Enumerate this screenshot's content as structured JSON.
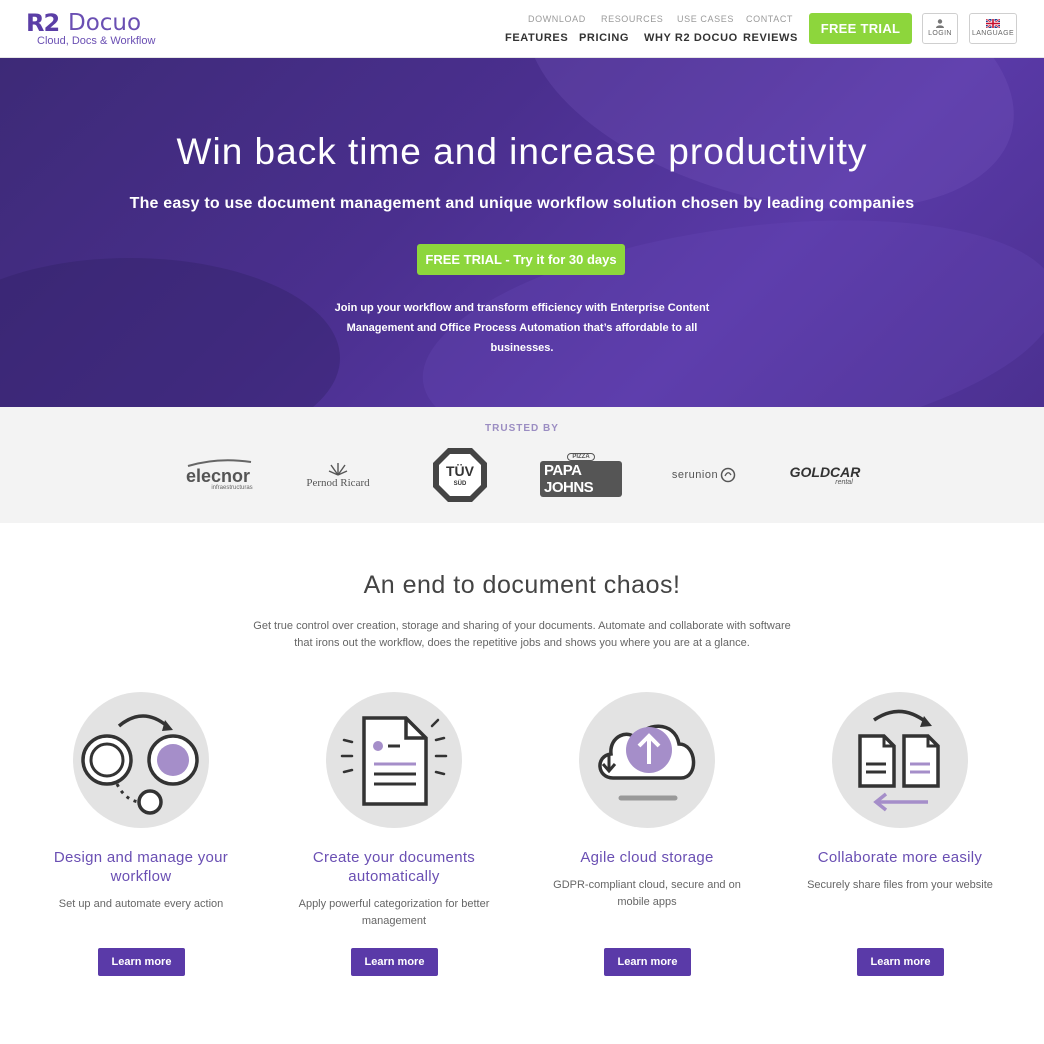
{
  "header": {
    "logo_mark": "R2",
    "logo_word": "Docuo",
    "logo_tagline": "Cloud, Docs & Workflow",
    "top_links": [
      "DOWNLOAD",
      "RESOURCES",
      "USE CASES",
      "CONTACT"
    ],
    "main_links": [
      "FEATURES",
      "PRICING",
      "WHY R2 DOCUO",
      "REVIEWS"
    ],
    "trial_button": "FREE TRIAL",
    "login_label": "LOGIN",
    "language_label": "LANGUAGE"
  },
  "hero": {
    "title": "Win back time and increase productivity",
    "subtitle": "The easy to use document management and unique workflow solution chosen by leading companies",
    "cta": "FREE TRIAL - Try it for 30 days",
    "description_line1": "Join up your workflow and transform efficiency with Enterprise Content",
    "description_line2": "Management and Office Process Automation that’s affordable to all businesses."
  },
  "trusted": {
    "label": "TRUSTED BY",
    "logos": [
      "elecnor",
      "infraestructuras",
      "Pernod Ricard",
      "TÜV",
      "SÜD",
      "PIZZA",
      "PAPA JOHNS",
      "serunion",
      "GOLDCAR",
      "rental"
    ]
  },
  "chaos": {
    "title": "An end to document chaos!",
    "description_line1": "Get true control over creation, storage and sharing of your documents. Automate and collaborate with software",
    "description_line2": "that irons out the workflow, does the repetitive jobs and shows you where you are at a glance."
  },
  "features": [
    {
      "title_line1": "Design and manage your",
      "title_line2": "workflow",
      "desc_line1": "Set up and automate every action",
      "desc_line2": "",
      "button": "Learn more",
      "icon": "workflow-icon"
    },
    {
      "title_line1": "Create your documents",
      "title_line2": "automatically",
      "desc_line1": "Apply powerful categorization for better",
      "desc_line2": "management",
      "button": "Learn more",
      "icon": "document-icon"
    },
    {
      "title_line1": "Agile cloud storage",
      "title_line2": "",
      "desc_line1": "GDPR-compliant cloud, secure and on",
      "desc_line2": "mobile apps",
      "button": "Learn more",
      "icon": "cloud-upload-icon"
    },
    {
      "title_line1": "Collaborate more easily",
      "title_line2": "",
      "desc_line1": "Securely share files from your website",
      "desc_line2": "",
      "button": "Learn more",
      "icon": "share-files-icon"
    }
  ],
  "colors": {
    "brand_purple": "#5a3aa8",
    "accent_green": "#8dd63c",
    "hero_bg": "#4a2f8e"
  }
}
